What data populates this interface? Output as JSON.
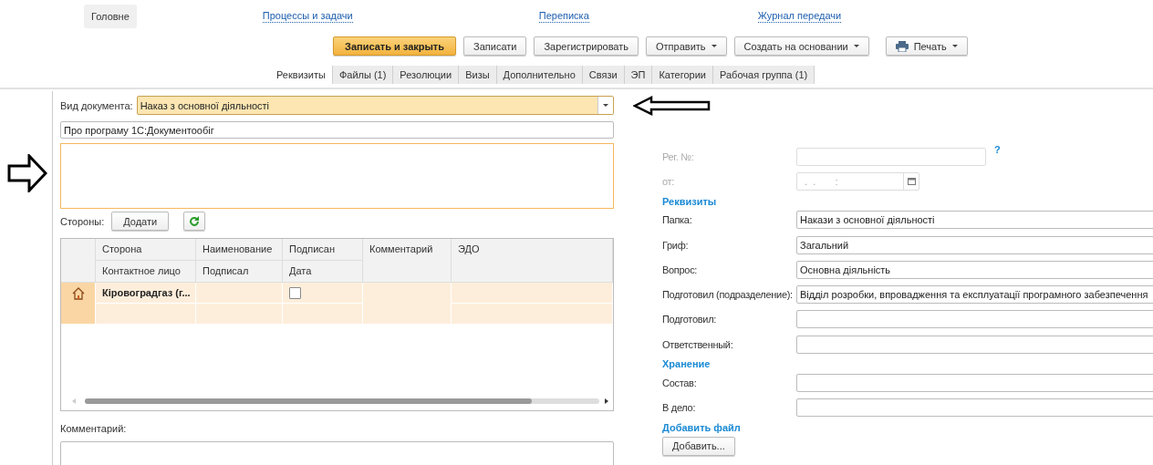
{
  "top_tabs": [
    {
      "label": "Головне",
      "selected": true
    }
  ],
  "nav_links": [
    "Процессы и задачи",
    "Переписка",
    "Журнал передачи"
  ],
  "toolbar": [
    {
      "label": "Записать и закрыть",
      "kind": "primary"
    },
    {
      "label": "Записати",
      "kind": "plain"
    },
    {
      "label": "Зарегистрировать",
      "kind": "plain"
    },
    {
      "label": "Отправить",
      "kind": "menu"
    },
    {
      "label": "Создать на основании",
      "kind": "menu"
    },
    {
      "label": "Печать",
      "kind": "print"
    }
  ],
  "tabs": [
    {
      "label": "Реквизиты",
      "selected": true
    },
    {
      "label": "Файлы (1)",
      "selected": false
    },
    {
      "label": "Резолюции",
      "selected": false
    },
    {
      "label": "Визы",
      "selected": false
    },
    {
      "label": "Дополнительно",
      "selected": false
    },
    {
      "label": "Связи",
      "selected": false
    },
    {
      "label": "ЭП",
      "selected": false
    },
    {
      "label": "Категории",
      "selected": false
    },
    {
      "label": "Рабочая группа (1)",
      "selected": false
    }
  ],
  "document_kind": {
    "label": "Вид документа:",
    "value": "Наказ з основної діяльності"
  },
  "title_field": {
    "value": "Про програму 1С:Документообіг"
  },
  "parties": {
    "label": "Стороны:",
    "add_button": "Додати",
    "columns": [
      {
        "top": "Сторона",
        "bottom": "Контактное лицо"
      },
      {
        "top": "Наименование",
        "bottom": "Подписал"
      },
      {
        "top": "Подписан",
        "bottom": "Дата"
      },
      {
        "top": "Комментарий"
      },
      {
        "top": "ЭДО"
      }
    ],
    "rows": [
      {
        "party": "Кіровоградгаз (г...",
        "signed": false,
        "selected": true
      }
    ]
  },
  "comment": {
    "label": "Комментарий:"
  },
  "registration": {
    "number_label": "Рег. №:",
    "help": "?",
    "date_label": "от:",
    "date_placeholder": ".  .       :"
  },
  "sections": [
    {
      "heading": "Реквизиты",
      "fields": [
        {
          "label": "Папка:",
          "value": "Накази з основної діяльності"
        },
        {
          "label": "Гриф:",
          "value": "Загальний"
        },
        {
          "label": "Вопрос:",
          "value": "Основна діяльність"
        },
        {
          "label": "Подготовил (подразделение):",
          "value": "Відділ розробки, впровадження та експлуатації програмного забезпечення"
        },
        {
          "label": "Подготовил:"
        },
        {
          "label": "Ответственный:"
        }
      ]
    },
    {
      "heading": "Хранение",
      "fields": [
        {
          "label": "Состав:"
        },
        {
          "label": "В дело:"
        }
      ]
    }
  ],
  "attach": {
    "heading": "Добавить файл",
    "button": "Добавить..."
  }
}
